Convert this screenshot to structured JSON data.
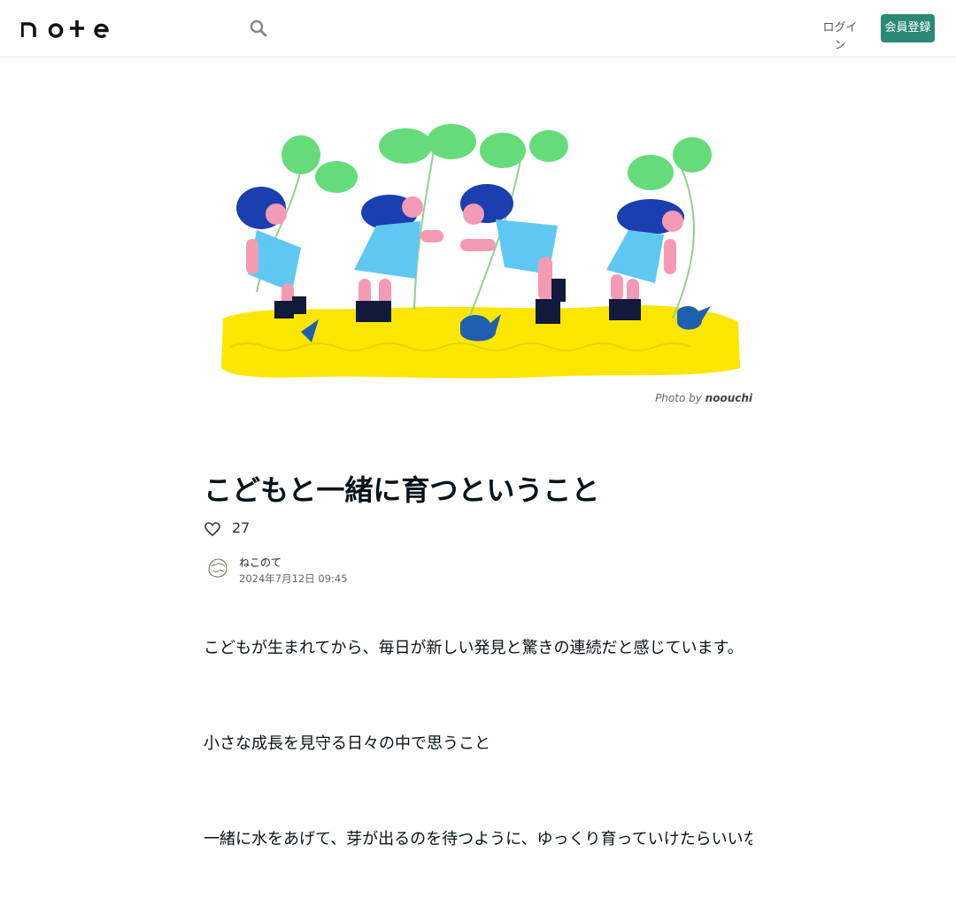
{
  "header": {
    "logo_text": "note",
    "search_icon": "search-icon",
    "login_label": "ログイン",
    "signup_label": "会員登録",
    "accent_color": "#2a8a76"
  },
  "hero": {
    "image_description_icon": "illustration-children-sprouts",
    "credit_prefix": "Photo by",
    "credit_author": "noouchi"
  },
  "article": {
    "title": "こどもと一緒に育つということ",
    "like_icon": "heart-icon",
    "like_count": "27",
    "author_name": "ねこのて",
    "date": "2024年7月12日 09:45",
    "paragraphs": [
      "こどもが生まれてから、毎日が新しい発見と驚きの連続だと感じています。",
      "小さな成長を見守る日々の中で思うこと",
      "一緒に水をあげて、芽が出るのを待つように、ゆっくり育っていけたらいいなと思います。"
    ]
  }
}
